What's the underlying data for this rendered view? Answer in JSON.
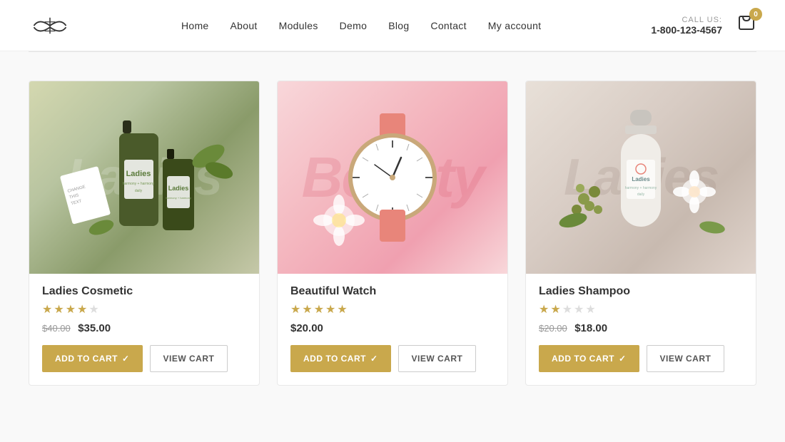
{
  "header": {
    "logo_alt": "Brand Logo",
    "call_label": "CALL US:",
    "call_number": "1-800-123-4567",
    "cart_badge": "0",
    "nav": [
      {
        "label": "Home",
        "id": "nav-home"
      },
      {
        "label": "About",
        "id": "nav-about"
      },
      {
        "label": "Modules",
        "id": "nav-modules"
      },
      {
        "label": "Demo",
        "id": "nav-demo"
      },
      {
        "label": "Blog",
        "id": "nav-blog"
      },
      {
        "label": "Contact",
        "id": "nav-contact"
      },
      {
        "label": "My account",
        "id": "nav-myaccount"
      }
    ]
  },
  "products": [
    {
      "id": "product-1",
      "name": "Ladies Cosmetic",
      "stars": [
        1,
        1,
        1,
        1,
        0
      ],
      "price_old": "$40.00",
      "price_new": "$35.00",
      "price_only": null,
      "bg_text": "Ladies",
      "type": "cosmetic",
      "add_to_cart_label": "ADD TO CART",
      "view_cart_label": "VIEW CART"
    },
    {
      "id": "product-2",
      "name": "Beautiful Watch",
      "stars": [
        1,
        1,
        1,
        1,
        1
      ],
      "price_old": null,
      "price_new": null,
      "price_only": "$20.00",
      "bg_text": "Beauty",
      "type": "watch",
      "add_to_cart_label": "ADD TO CART",
      "view_cart_label": "VIEW CART"
    },
    {
      "id": "product-3",
      "name": "Ladies Shampoo",
      "stars": [
        1,
        1,
        0,
        0,
        0
      ],
      "price_old": "$20.00",
      "price_new": "$18.00",
      "price_only": null,
      "bg_text": "Ladies",
      "type": "shampoo",
      "add_to_cart_label": "ADD TO CART",
      "view_cart_label": "VIEW CART"
    }
  ]
}
